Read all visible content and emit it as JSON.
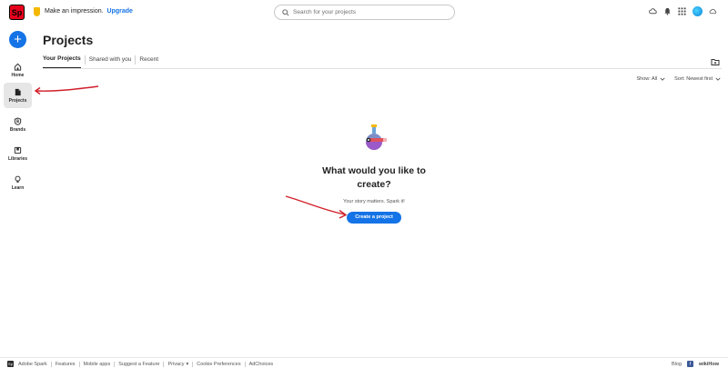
{
  "app": {
    "logo_text": "Sp"
  },
  "header": {
    "promo_text": "Make an impression.",
    "upgrade_label": "Upgrade",
    "search_placeholder": "Search for your projects"
  },
  "sidebar": {
    "create_label": "+",
    "items": [
      {
        "label": "Home",
        "icon": "home-icon"
      },
      {
        "label": "Projects",
        "icon": "projects-icon",
        "active": true
      },
      {
        "label": "Brands",
        "icon": "brands-icon"
      },
      {
        "label": "Libraries",
        "icon": "libraries-icon"
      },
      {
        "label": "Learn",
        "icon": "lightbulb-icon"
      }
    ]
  },
  "main": {
    "title": "Projects",
    "tabs": [
      {
        "label": "Your Projects",
        "active": true
      },
      {
        "label": "Shared with you"
      },
      {
        "label": "Recent"
      }
    ],
    "filters": {
      "show": "Show: All",
      "sort": "Sort: Newest first"
    },
    "empty_state": {
      "heading": "What would you like to create?",
      "subtext": "Your story matters. Spark it!",
      "button_label": "Create a project"
    }
  },
  "footer": {
    "brand": "Adobe Spark",
    "links": [
      "Features",
      "Mobile apps",
      "Suggest a Feature",
      "Privacy",
      "Cookie Preferences",
      "AdChoices"
    ],
    "right_links": [
      "Blog"
    ],
    "watermark": "wikiHow"
  },
  "colors": {
    "accent": "#1473e6",
    "brand_red": "#e8001c",
    "annotation_arrow": "#d0202a"
  }
}
